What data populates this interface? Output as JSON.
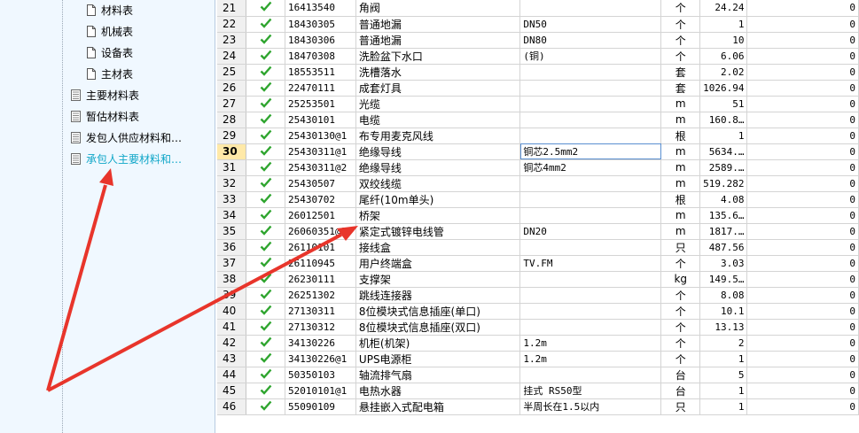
{
  "tree": {
    "sub_items": [
      {
        "label": "材料表"
      },
      {
        "label": "机械表"
      },
      {
        "label": "设备表"
      },
      {
        "label": "主材表"
      }
    ],
    "items": [
      {
        "label": "主要材料表"
      },
      {
        "label": "暂估材料表"
      },
      {
        "label": "发包人供应材料和…"
      },
      {
        "label": "承包人主要材料和…"
      }
    ]
  },
  "grid": {
    "rows": [
      {
        "n": "21",
        "code": "16413540",
        "name": "角阀",
        "spec": "",
        "unit": "个",
        "qty": "24.24",
        "val": "0"
      },
      {
        "n": "22",
        "code": "18430305",
        "name": "普通地漏",
        "spec": "DN50",
        "unit": "个",
        "qty": "1",
        "val": "0"
      },
      {
        "n": "23",
        "code": "18430306",
        "name": "普通地漏",
        "spec": "DN80",
        "unit": "个",
        "qty": "10",
        "val": "0"
      },
      {
        "n": "24",
        "code": "18470308",
        "name": "洗脸盆下水口",
        "spec": "(铜)",
        "unit": "个",
        "qty": "6.06",
        "val": "0"
      },
      {
        "n": "25",
        "code": "18553511",
        "name": "洗槽落水",
        "spec": "",
        "unit": "套",
        "qty": "2.02",
        "val": "0"
      },
      {
        "n": "26",
        "code": "22470111",
        "name": "成套灯具",
        "spec": "",
        "unit": "套",
        "qty": "1026.94",
        "val": "0"
      },
      {
        "n": "27",
        "code": "25253501",
        "name": "光缆",
        "spec": "",
        "unit": "m",
        "qty": "51",
        "val": "0"
      },
      {
        "n": "28",
        "code": "25430101",
        "name": "电缆",
        "spec": "",
        "unit": "m",
        "qty": "160.8…",
        "val": "0"
      },
      {
        "n": "29",
        "code": "25430130@1",
        "name": "布专用麦克风线",
        "spec": "",
        "unit": "根",
        "qty": "1",
        "val": "0"
      },
      {
        "n": "30",
        "code": "25430311@1",
        "name": "绝缘导线",
        "spec": "铜芯2.5mm2",
        "unit": "m",
        "qty": "5634.…",
        "val": "0"
      },
      {
        "n": "31",
        "code": "25430311@2",
        "name": "绝缘导线",
        "spec": "铜芯4mm2",
        "unit": "m",
        "qty": "2589.…",
        "val": "0"
      },
      {
        "n": "32",
        "code": "25430507",
        "name": "双绞线缆",
        "spec": "",
        "unit": "m",
        "qty": "519.282",
        "val": "0"
      },
      {
        "n": "33",
        "code": "25430702",
        "name": "尾纤(10m单头)",
        "spec": "",
        "unit": "根",
        "qty": "4.08",
        "val": "0"
      },
      {
        "n": "34",
        "code": "26012501",
        "name": "桥架",
        "spec": "",
        "unit": "m",
        "qty": "135.6…",
        "val": "0"
      },
      {
        "n": "35",
        "code": "26060351@1",
        "name": "紧定式镀锌电线管",
        "spec": "DN20",
        "unit": "m",
        "qty": "1817.…",
        "val": "0"
      },
      {
        "n": "36",
        "code": "26110101",
        "name": "接线盒",
        "spec": "",
        "unit": "只",
        "qty": "487.56",
        "val": "0"
      },
      {
        "n": "37",
        "code": "26110945",
        "name": "用户终端盒",
        "spec": "TV.FM",
        "unit": "个",
        "qty": "3.03",
        "val": "0"
      },
      {
        "n": "38",
        "code": "26230111",
        "name": "支撑架",
        "spec": "",
        "unit": "kg",
        "qty": "149.5…",
        "val": "0"
      },
      {
        "n": "39",
        "code": "26251302",
        "name": "跳线连接器",
        "spec": "",
        "unit": "个",
        "qty": "8.08",
        "val": "0"
      },
      {
        "n": "40",
        "code": "27130311",
        "name": "8位模块式信息插座(单口)",
        "spec": "",
        "unit": "个",
        "qty": "10.1",
        "val": "0"
      },
      {
        "n": "41",
        "code": "27130312",
        "name": "8位模块式信息插座(双口)",
        "spec": "",
        "unit": "个",
        "qty": "13.13",
        "val": "0"
      },
      {
        "n": "42",
        "code": "34130226",
        "name": "机柜(机架)",
        "spec": "1.2m",
        "unit": "个",
        "qty": "2",
        "val": "0"
      },
      {
        "n": "43",
        "code": "34130226@1",
        "name": "UPS电源柜",
        "spec": "1.2m",
        "unit": "个",
        "qty": "1",
        "val": "0"
      },
      {
        "n": "44",
        "code": "50350103",
        "name": "轴流排气扇",
        "spec": "",
        "unit": "台",
        "qty": "5",
        "val": "0"
      },
      {
        "n": "45",
        "code": "52010101@1",
        "name": "电热水器",
        "spec": "挂式 RS50型",
        "unit": "台",
        "qty": "1",
        "val": "0"
      },
      {
        "n": "46",
        "code": "55090109",
        "name": "悬挂嵌入式配电箱",
        "spec": "半周长在1.5以内",
        "unit": "只",
        "qty": "1",
        "val": "0"
      }
    ]
  },
  "colors": {
    "accent": "#0fa6c8",
    "arrow": "#e8352b",
    "check": "#2fa52f",
    "tree_bg": "#f0f8ff"
  }
}
